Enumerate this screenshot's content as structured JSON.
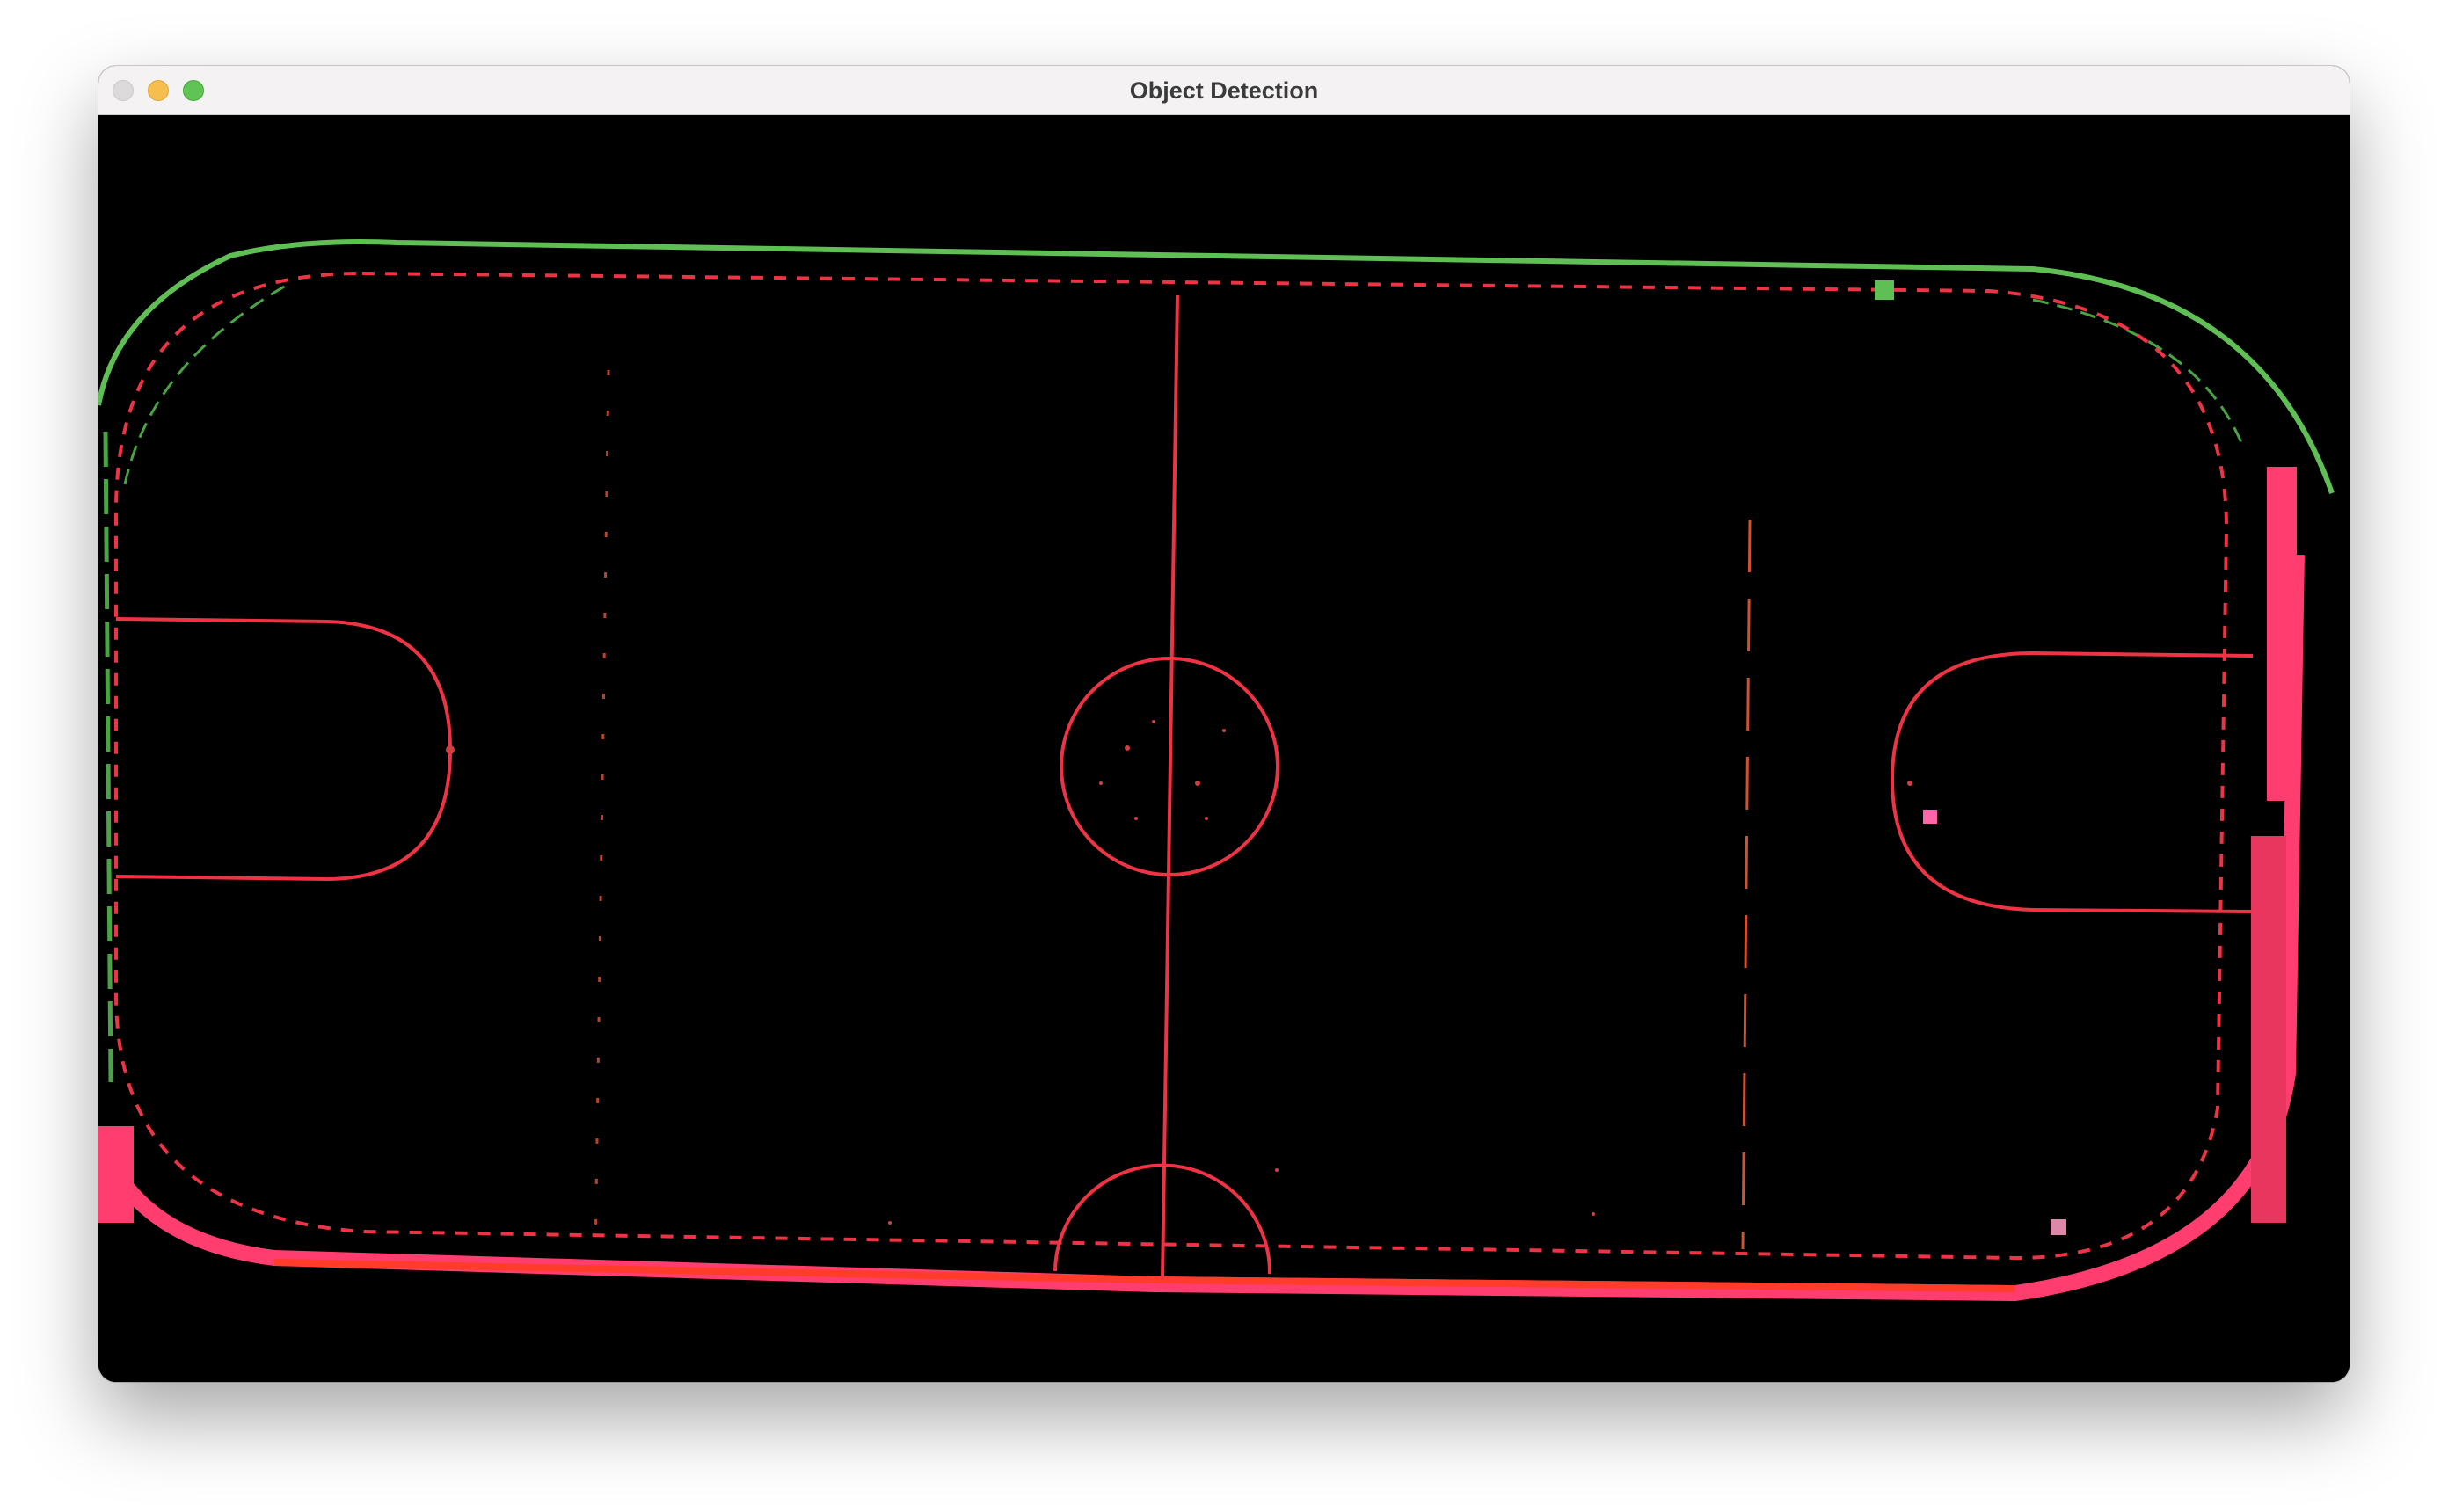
{
  "window": {
    "title": "Object Detection"
  },
  "detection_view": {
    "background_color": "#000000",
    "line_color": "#ee3344",
    "board_top_color": "#5fbf55",
    "board_bottom_color": "#ff3d6e",
    "noise_color": "#d04040"
  },
  "icons": {
    "close": "close-dot-icon",
    "minimize": "minimize-dot-icon",
    "zoom": "zoom-dot-icon"
  }
}
